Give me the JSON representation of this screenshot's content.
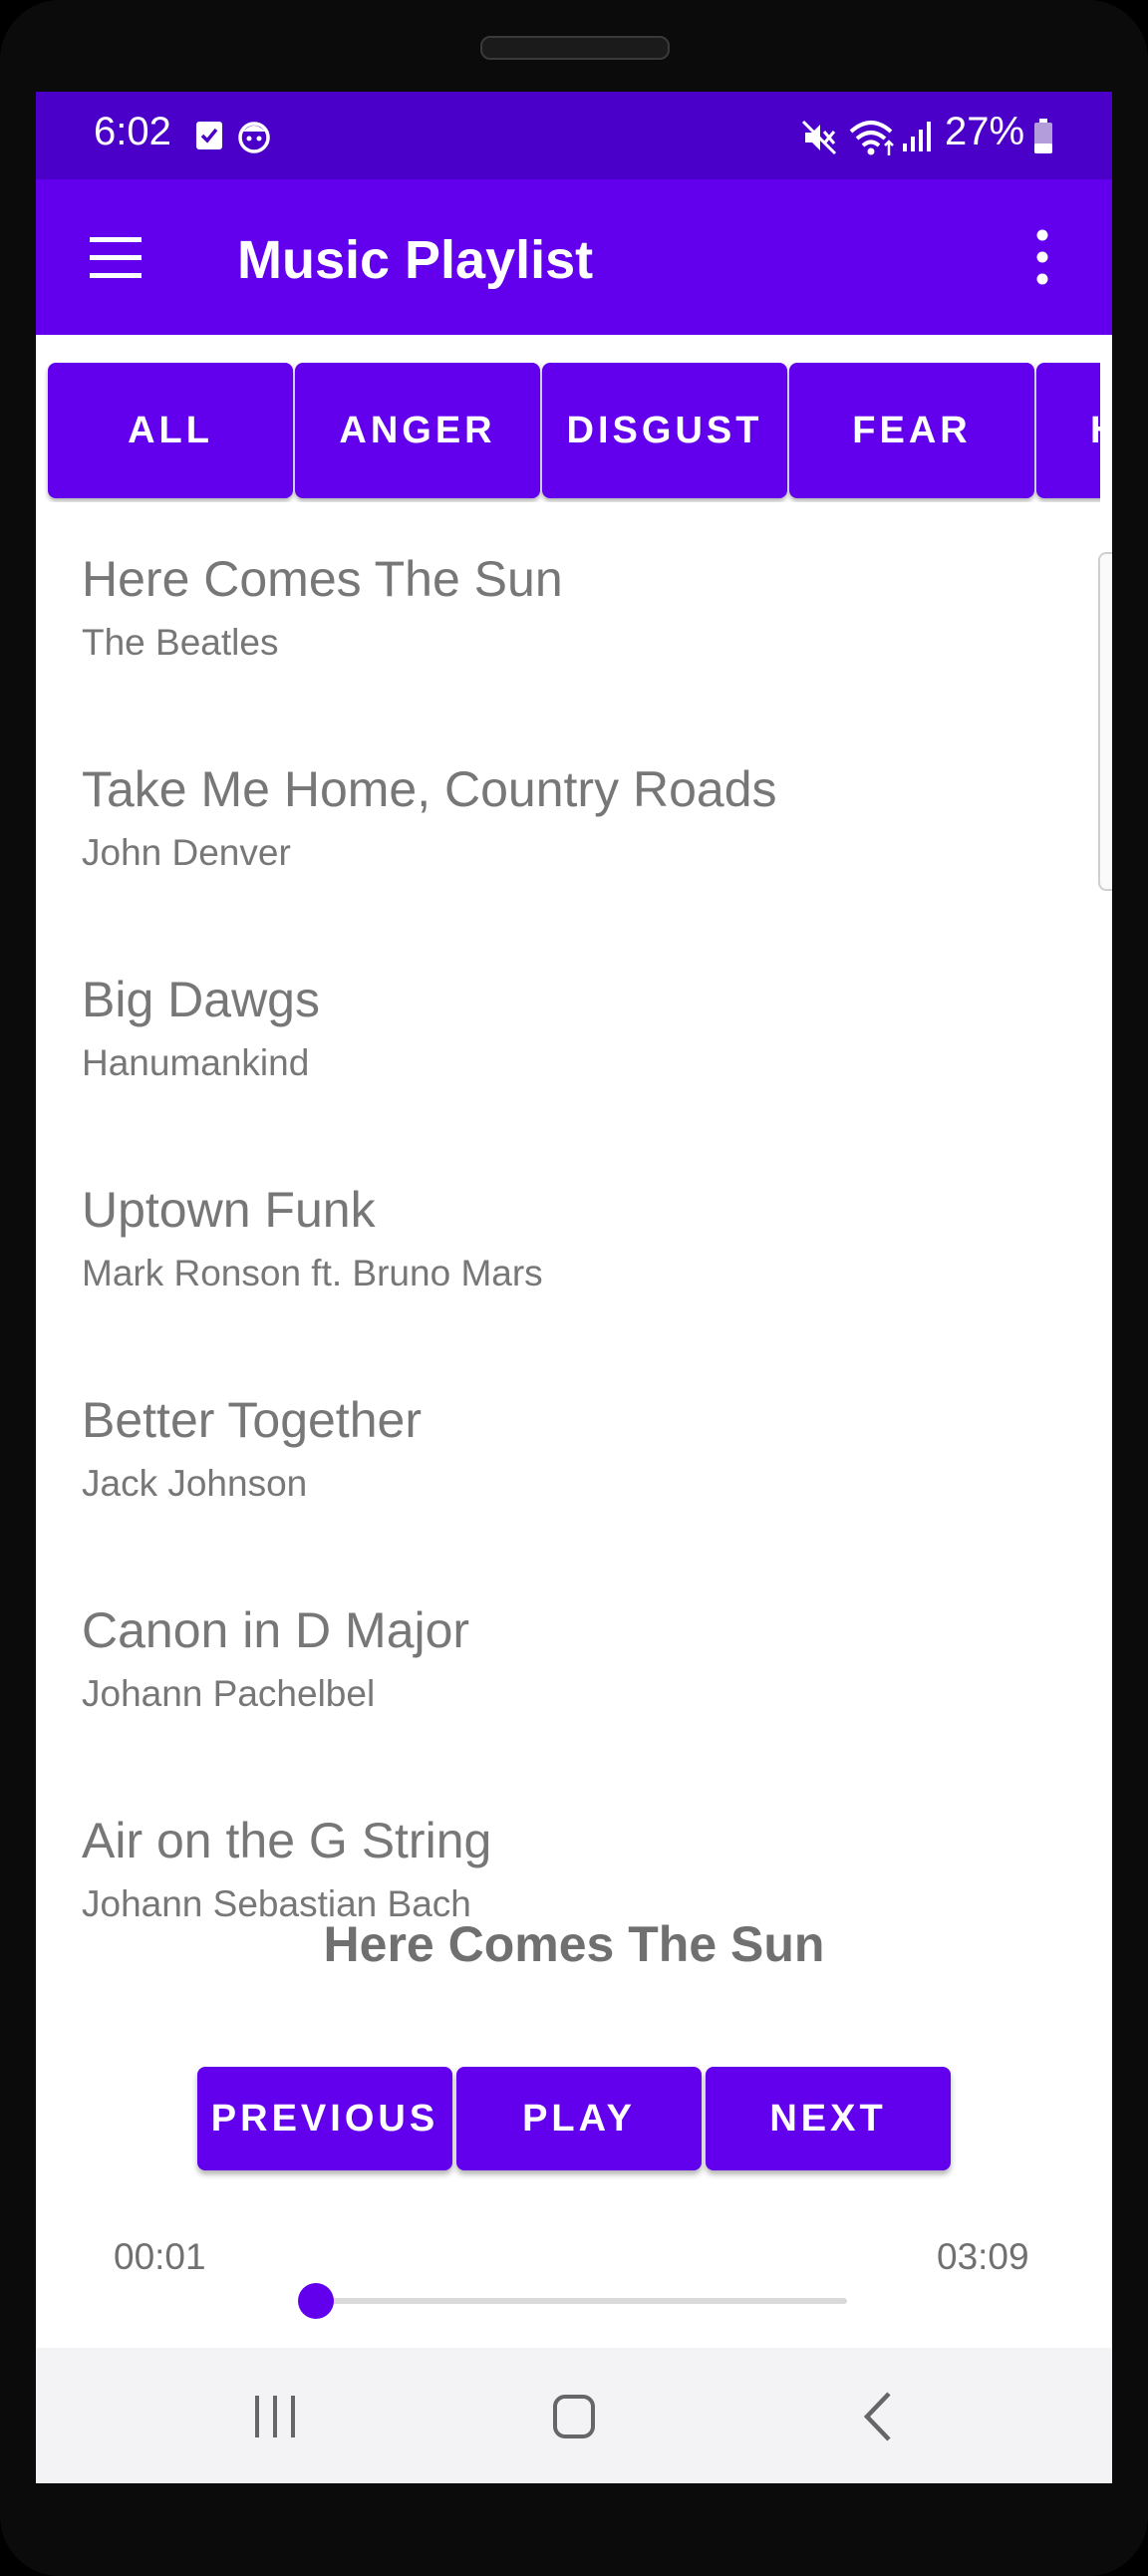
{
  "status_bar": {
    "time": "6:02",
    "battery": "27%",
    "icons": [
      "checkbox-notification-icon",
      "face-notification-icon",
      "mute-icon",
      "wifi-icon",
      "signal-icon",
      "battery-icon"
    ]
  },
  "app_bar": {
    "title": "Music Playlist",
    "menu_icon": "hamburger-menu-icon",
    "overflow_icon": "more-vert-icon"
  },
  "filters": [
    "ALL",
    "ANGER",
    "DISGUST",
    "FEAR",
    "H"
  ],
  "songs": [
    {
      "title": "Here Comes The Sun",
      "artist": "The Beatles"
    },
    {
      "title": "Take Me Home, Country Roads",
      "artist": "John Denver"
    },
    {
      "title": "Big Dawgs",
      "artist": "Hanumankind"
    },
    {
      "title": "Uptown Funk",
      "artist": "Mark Ronson ft. Bruno Mars"
    },
    {
      "title": "Better Together",
      "artist": "Jack Johnson"
    },
    {
      "title": "Canon in D Major",
      "artist": "Johann Pachelbel"
    },
    {
      "title": "Air on the G String",
      "artist": "Johann Sebastian Bach"
    }
  ],
  "player": {
    "now_playing": "Here Comes The Sun",
    "previous_label": "PREVIOUS",
    "play_label": "PLAY",
    "next_label": "NEXT",
    "elapsed": "00:01",
    "total": "03:09",
    "progress": 0.005
  },
  "nav_bar": {
    "icons": [
      "recent-apps-icon",
      "home-icon",
      "back-icon"
    ]
  },
  "colors": {
    "primary": "#6200ee",
    "status_bar": "#4b00c9",
    "text_secondary": "#777777"
  }
}
